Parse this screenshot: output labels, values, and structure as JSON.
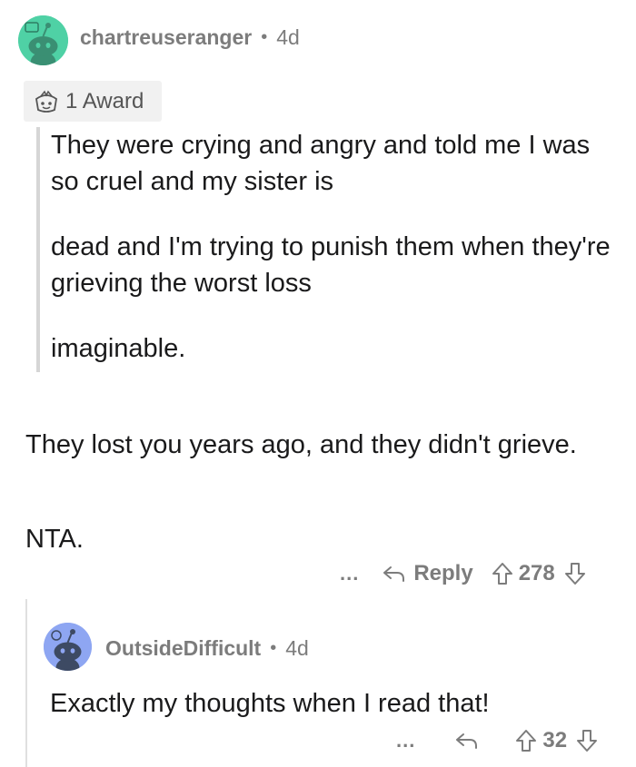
{
  "comment": {
    "username": "chartreuseranger",
    "separator": "•",
    "age": "4d",
    "award_label": "1 Award",
    "quote_paragraphs": [
      "They were crying and angry and told me I was so cruel and my sister is",
      "dead and I'm trying to punish them when they're grieving the worst loss",
      "imaginable."
    ],
    "body_paragraphs": [
      "They lost you years ago, and they didn't grieve.",
      "NTA."
    ],
    "actions": {
      "more": "...",
      "reply_label": "Reply",
      "score": "278"
    },
    "avatar_bg": "#4fd1a5"
  },
  "reply": {
    "username": "OutsideDifficult",
    "separator": "•",
    "age": "4d",
    "body": "Exactly my thoughts when I read that!",
    "actions": {
      "more": "...",
      "score": "32"
    },
    "avatar_bg": "#8ea6f2"
  }
}
